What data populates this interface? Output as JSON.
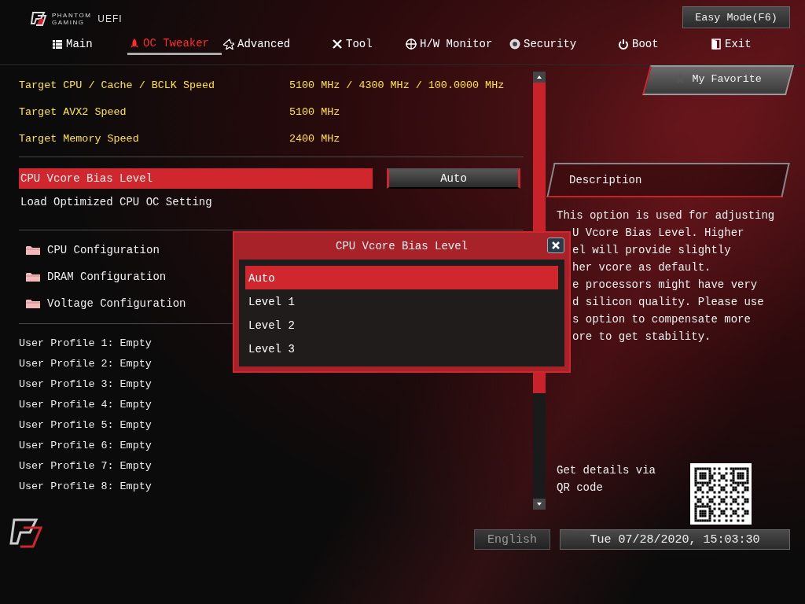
{
  "logo": {
    "line_1": "PHANTOM",
    "line_2": "GAMING",
    "product": "UEFI"
  },
  "easy_mode_button": "Easy Mode(F6)",
  "tabs": [
    {
      "label": "Main",
      "selected": false
    },
    {
      "label": "OC Tweaker",
      "selected": true
    },
    {
      "label": "Advanced",
      "selected": false
    },
    {
      "label": "Tool",
      "selected": false
    },
    {
      "label": "H/W Monitor",
      "selected": false
    },
    {
      "label": "Security",
      "selected": false
    },
    {
      "label": "Boot",
      "selected": false
    },
    {
      "label": "Exit",
      "selected": false
    }
  ],
  "favorite_button": "My Favorite",
  "targets": [
    {
      "label": "Target CPU / Cache / BCLK Speed",
      "value": "5100 MHz / 4300 MHz / 100.0000 MHz"
    },
    {
      "label": "Target AVX2 Speed",
      "value": "5100 MHz"
    },
    {
      "label": "Target Memory Speed",
      "value": "2400 MHz"
    }
  ],
  "settings": [
    {
      "label": "CPU Vcore Bias Level",
      "value": "Auto",
      "selected": true
    },
    {
      "label": "Load Optimized CPU OC Setting",
      "selected": false
    }
  ],
  "folders": [
    "CPU Configuration",
    "DRAM Configuration",
    "Voltage Configuration"
  ],
  "profiles": [
    "User Profile 1: Empty",
    "User Profile 2: Empty",
    "User Profile 3: Empty",
    "User Profile 4: Empty",
    "User Profile 5: Empty",
    "User Profile 6: Empty",
    "User Profile 7: Empty",
    "User Profile 8: Empty"
  ],
  "description": {
    "title": "Description",
    "lines": [
      "This option is used for adjusting",
      "U Vcore Bias Level. Higher",
      "el will provide slightly",
      "her vcore as default.",
      "e processors might have very",
      "d silicon quality. Please use",
      "s option to compensate more",
      "ore to get stability."
    ]
  },
  "qr_text": "Get details via QR code",
  "popup": {
    "title": "CPU Vcore Bias Level",
    "options": [
      {
        "label": "Auto",
        "selected": true
      },
      {
        "label": "Level 1",
        "selected": false
      },
      {
        "label": "Level 2",
        "selected": false
      },
      {
        "label": "Level 3",
        "selected": false
      }
    ]
  },
  "footer": {
    "language": "English",
    "datetime": "Tue 07/28/2020, 15:03:30"
  }
}
